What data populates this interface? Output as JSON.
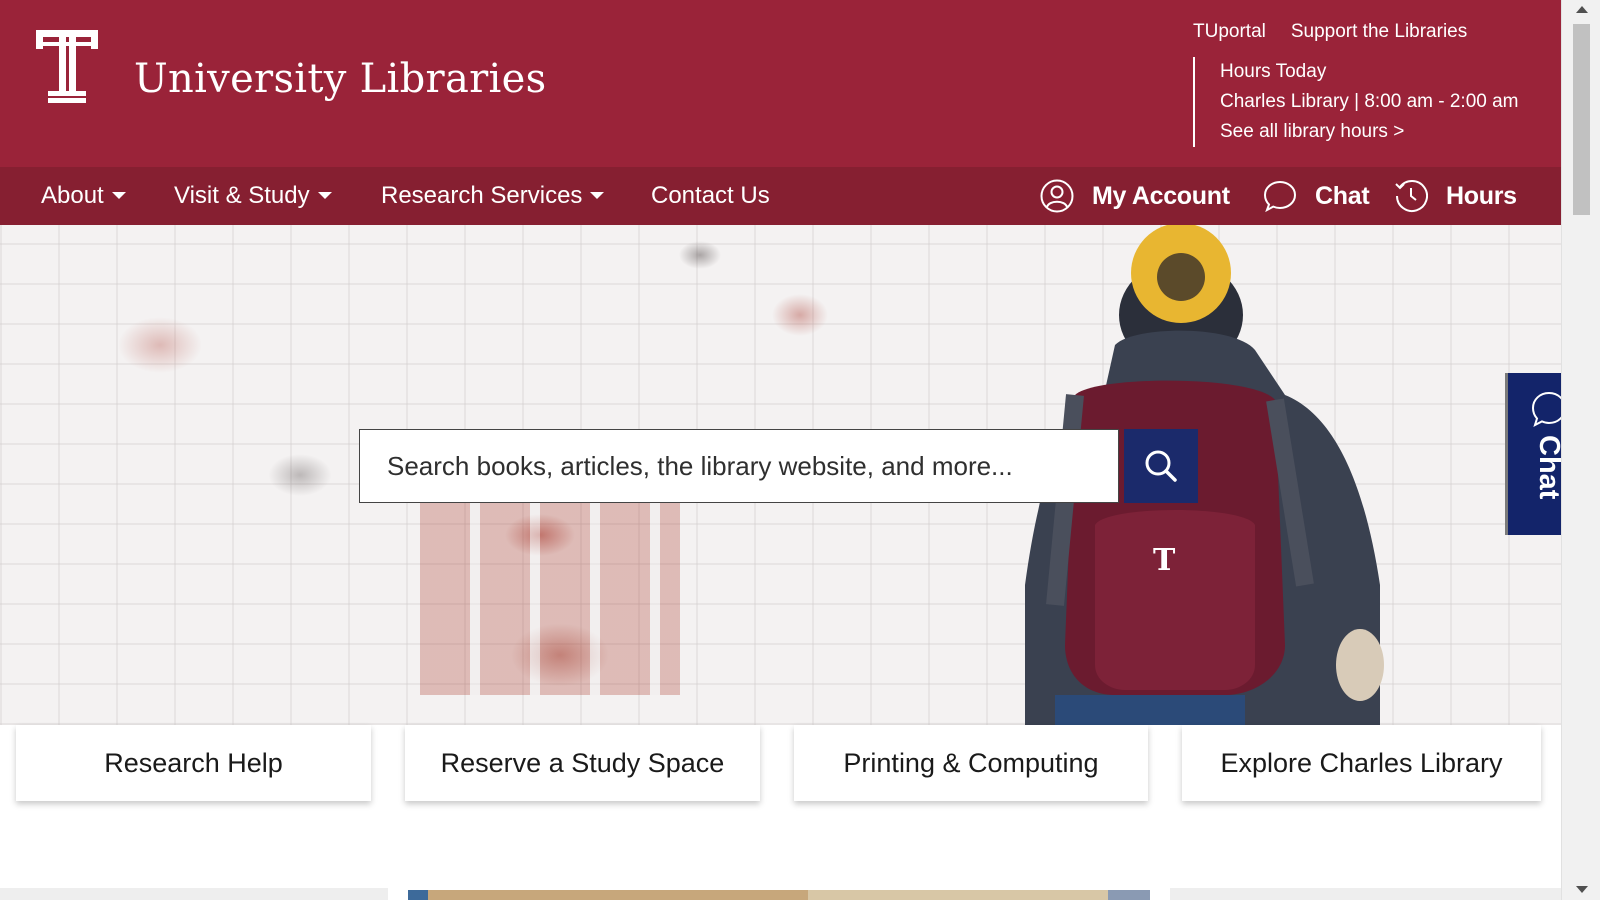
{
  "header": {
    "site_title": "University Libraries",
    "logo_icon": "temple-t-logo",
    "util_links": [
      "TUportal",
      "Support the Libraries"
    ],
    "hours": {
      "heading": "Hours Today",
      "detail": "Charles Library | 8:00 am - 2:00 am",
      "link": "See all library hours >"
    }
  },
  "nav": {
    "items": [
      {
        "label": "About",
        "dropdown": true
      },
      {
        "label": "Visit & Study",
        "dropdown": true
      },
      {
        "label": "Research Services",
        "dropdown": true
      },
      {
        "label": "Contact Us",
        "dropdown": false
      }
    ],
    "right": [
      {
        "label": "My Account",
        "icon": "user-circle-icon"
      },
      {
        "label": "Chat",
        "icon": "speech-bubble-icon"
      },
      {
        "label": "Hours",
        "icon": "clock-icon"
      }
    ]
  },
  "search": {
    "placeholder": "Search books, articles, the library website, and more...",
    "button_icon": "search-icon"
  },
  "chat_tab": {
    "label": "Chat",
    "icon": "speech-bubble-icon"
  },
  "quick_links": [
    {
      "label": "Research Help"
    },
    {
      "label": "Reserve a Study Space"
    },
    {
      "label": "Printing & Computing"
    },
    {
      "label": "Explore Charles Library"
    }
  ],
  "colors": {
    "header_bg": "#9a2339",
    "nav_bg": "#861f31",
    "search_button": "#1b2a6b",
    "chat_tab": "#13246a"
  }
}
